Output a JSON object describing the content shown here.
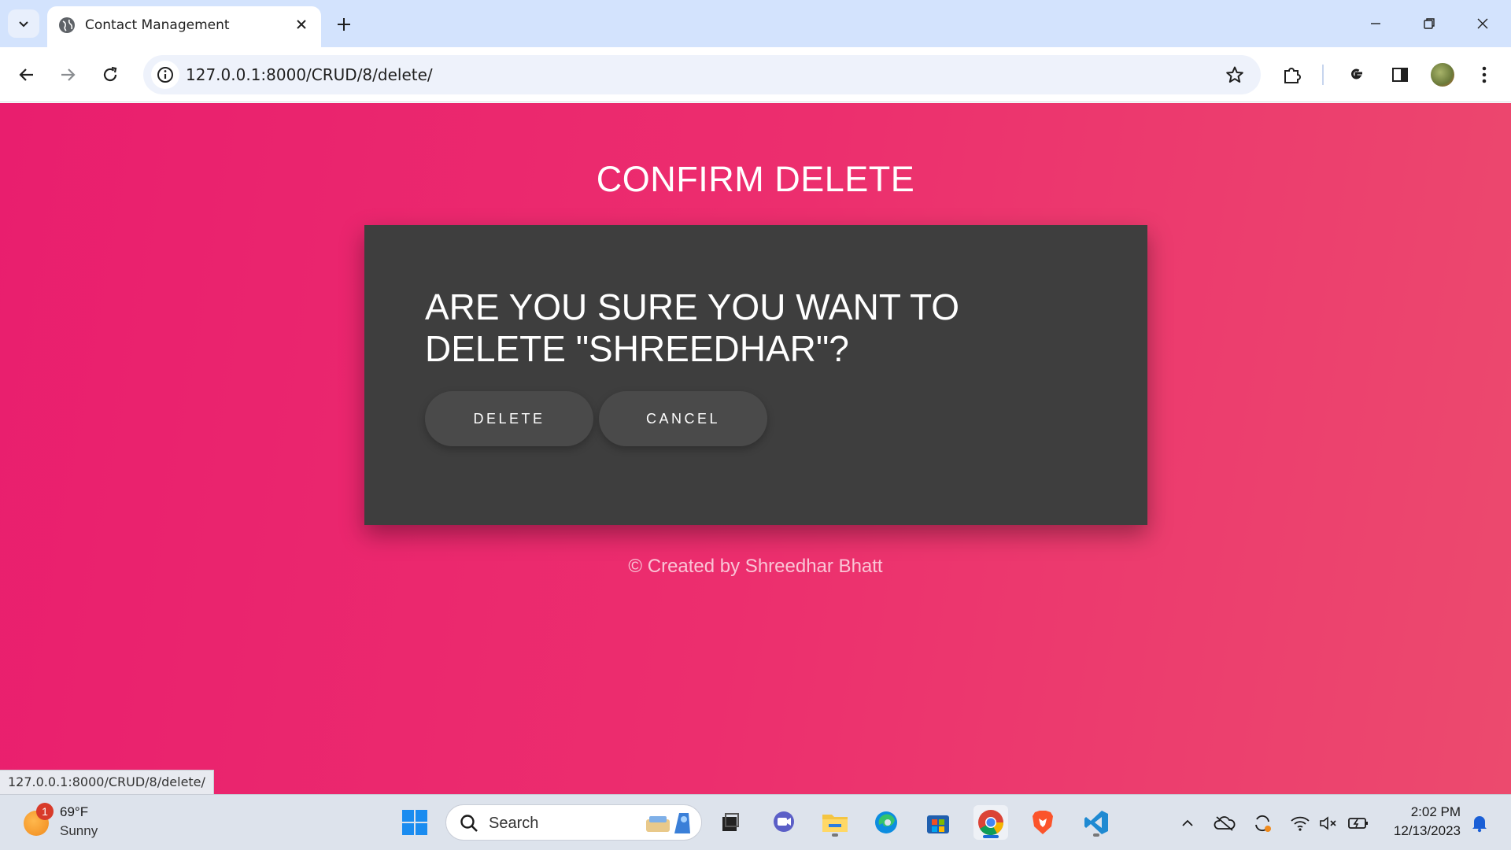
{
  "browser": {
    "tab_title": "Contact Management",
    "url": "127.0.0.1:8000/CRUD/8/delete/",
    "status_url": "127.0.0.1:8000/CRUD/8/delete/"
  },
  "page": {
    "title": "CONFIRM DELETE",
    "question_line1": "ARE YOU SURE YOU WANT TO",
    "question_line2": "DELETE \"SHREEDHAR\"?",
    "delete_label": "DELETE",
    "cancel_label": "CANCEL",
    "footer": "© Created by Shreedhar Bhatt",
    "colors": {
      "background_start": "#e91e6e",
      "background_end": "#ec4a6e",
      "card": "#3e3e3e",
      "button": "#4a4a4a"
    }
  },
  "taskbar": {
    "weather_badge": "1",
    "weather_temp": "69°F",
    "weather_condition": "Sunny",
    "search_placeholder": "Search",
    "apps": [
      "windows-start-icon",
      "file-explorer-dark-icon",
      "teams-chat-icon",
      "file-explorer-icon",
      "edge-icon",
      "microsoft-store-icon",
      "chrome-icon",
      "brave-icon",
      "vscode-icon"
    ],
    "clock_time": "2:02 PM",
    "clock_date": "12/13/2023"
  }
}
